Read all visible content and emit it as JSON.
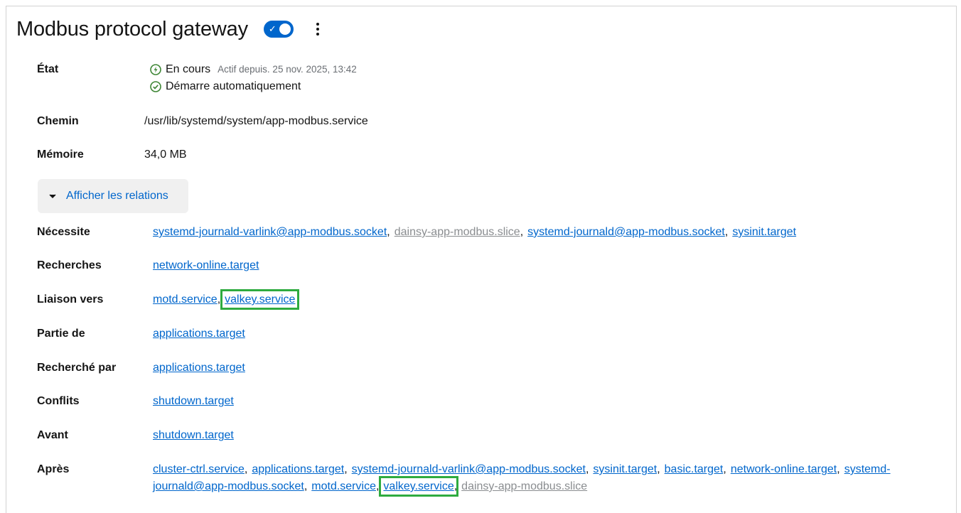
{
  "header": {
    "title": "Modbus protocol gateway",
    "toggle_state": "on"
  },
  "details": {
    "state_label": "État",
    "state_value": "En cours",
    "state_since": "Actif depuis. 25 nov. 2025, 13:42",
    "autostart": "Démarre automatiquement",
    "path_label": "Chemin",
    "path_value": "/usr/lib/systemd/system/app-modbus.service",
    "memory_label": "Mémoire",
    "memory_value": "34,0 MB"
  },
  "relations_button": "Afficher les relations",
  "relations": [
    {
      "label": "Nécessite",
      "links": [
        {
          "text": "systemd-journald-varlink@app-modbus.socket"
        },
        {
          "text": "dainsy-app-modbus.slice",
          "dim": true
        },
        {
          "text": "systemd-journald@app-modbus.socket"
        },
        {
          "text": "sysinit.target"
        }
      ]
    },
    {
      "label": "Recherches",
      "links": [
        {
          "text": "network-online.target"
        }
      ]
    },
    {
      "label": "Liaison vers",
      "links": [
        {
          "text": "motd.service"
        },
        {
          "text": "valkey.service",
          "highlight": true
        }
      ]
    },
    {
      "label": "Partie de",
      "links": [
        {
          "text": "applications.target"
        }
      ]
    },
    {
      "label": "Recherché par",
      "links": [
        {
          "text": "applications.target"
        }
      ]
    },
    {
      "label": "Conflits",
      "links": [
        {
          "text": "shutdown.target"
        }
      ]
    },
    {
      "label": "Avant",
      "links": [
        {
          "text": "shutdown.target"
        }
      ]
    },
    {
      "label": "Après",
      "links": [
        {
          "text": "cluster-ctrl.service"
        },
        {
          "text": "applications.target"
        },
        {
          "text": "systemd-journald-varlink@app-modbus.socket"
        },
        {
          "text": "sysinit.target"
        },
        {
          "text": "basic.target"
        },
        {
          "text": "network-online.target"
        },
        {
          "text": "systemd-journald@app-modbus.socket"
        },
        {
          "text": "motd.service"
        },
        {
          "text": "valkey.service",
          "highlight": true
        },
        {
          "text": "dainsy-app-modbus.slice",
          "dim": true
        }
      ]
    }
  ],
  "colors": {
    "link": "#0066cc",
    "dim_link": "#8a8d90",
    "highlight": "#2eab3f",
    "running": "#3e8635",
    "toggle": "#0066cc"
  }
}
